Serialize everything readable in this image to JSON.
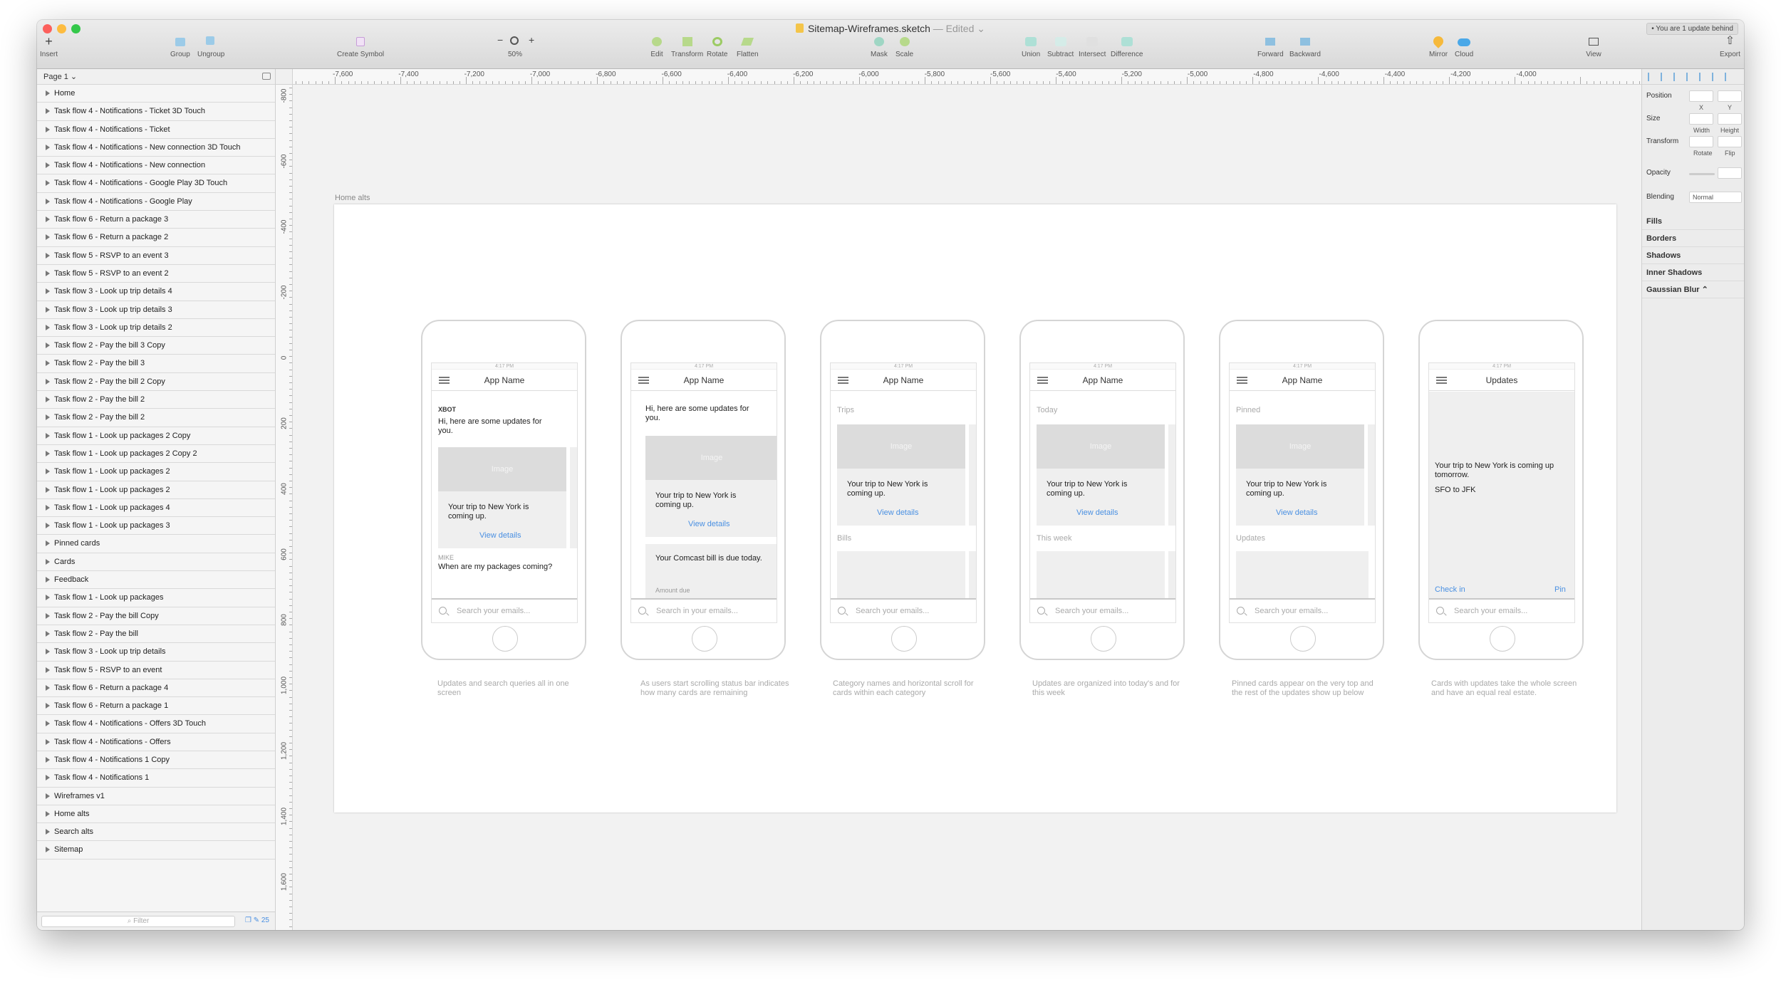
{
  "window": {
    "title": "Sitemap-Wireframes.sketch",
    "edited": " — Edited ⌄",
    "update_badge": "• You are 1 update behind"
  },
  "toolbar": {
    "insert": "Insert",
    "group": "Group",
    "ungroup": "Ungroup",
    "create_symbol": "Create Symbol",
    "zoom": "50%",
    "zoom_minus": "−",
    "zoom_plus": "+",
    "edit": "Edit",
    "transform": "Transform",
    "rotate": "Rotate",
    "flatten": "Flatten",
    "mask": "Mask",
    "scale": "Scale",
    "union": "Union",
    "subtract": "Subtract",
    "intersect": "Intersect",
    "difference": "Difference",
    "forward": "Forward",
    "backward": "Backward",
    "mirror": "Mirror",
    "cloud": "Cloud",
    "view": "View",
    "export": "Export"
  },
  "layers": {
    "page": "Page 1 ⌄",
    "items": [
      "Home",
      "Task flow 4 - Notifications - Ticket 3D Touch",
      "Task flow 4 - Notifications - Ticket",
      "Task flow 4 - Notifications - New connection 3D Touch",
      "Task flow 4 - Notifications - New connection",
      "Task flow 4 - Notifications - Google Play 3D Touch",
      "Task flow 4 - Notifications - Google Play",
      "Task flow 6 - Return a package 3",
      "Task flow 6 - Return a package 2",
      "Task flow 5 - RSVP to an event 3",
      "Task flow 5 - RSVP to an event 2",
      "Task flow 3 - Look up trip details 4",
      "Task flow 3 - Look up trip details 3",
      "Task flow 3 - Look up trip details 2",
      "Task flow 2 - Pay the bill 3 Copy",
      "Task flow 2 - Pay the bill 3",
      "Task flow 2 - Pay the bill 2 Copy",
      "Task flow 2 - Pay the bill 2",
      "Task flow 2 - Pay the bill 2",
      "Task flow 1 - Look up packages 2 Copy",
      "Task flow 1 - Look up packages 2 Copy 2",
      "Task flow 1 - Look up packages 2",
      "Task flow 1 - Look up packages 2",
      "Task flow 1 - Look up packages 4",
      "Task flow 1 - Look up packages 3",
      "Pinned cards",
      "Cards",
      "Feedback",
      "Task flow 1 - Look up packages",
      "Task flow 2 - Pay the bill Copy",
      "Task flow 2 - Pay the bill",
      "Task flow 3 - Look up trip details",
      "Task flow 5 - RSVP to an event",
      "Task flow 6 - Return a package 4",
      "Task flow 6 - Return a package 1",
      "Task flow 4 - Notifications - Offers 3D Touch",
      "Task flow 4 - Notifications - Offers",
      "Task flow 4 - Notifications 1 Copy",
      "Task flow 4 - Notifications 1",
      "Wireframes v1",
      "Home alts",
      "Search alts",
      "Sitemap"
    ],
    "filter_placeholder": "Filter",
    "count": "25"
  },
  "rulers": {
    "h": [
      "-7,600",
      "-7,400",
      "-7,200",
      "-7,000",
      "-6,800",
      "-6,600",
      "-6,400",
      "-6,200",
      "-6,000",
      "-5,800",
      "-5,600",
      "-5,400",
      "-5,200",
      "-5,000",
      "-4,800",
      "-4,600",
      "-4,400",
      "-4,200",
      "-4,000"
    ],
    "v": [
      "-800",
      "-600",
      "-400",
      "-200",
      "0",
      "200",
      "400",
      "600",
      "800",
      "1,000",
      "1,200",
      "1,400",
      "1,600"
    ]
  },
  "artboard": {
    "name": "Home alts"
  },
  "phones": {
    "time": "4:17 PM",
    "app_name": "App Name",
    "search": "Search your emails...",
    "p1": {
      "sender": "XBOT",
      "greeting": "Hi, here are some updates for you.",
      "image": "Image",
      "card": "Your trip to New York is coming up.",
      "link": "View details",
      "sender2": "MIKE",
      "question": "When are my packages coming?"
    },
    "p2": {
      "greeting": "Hi, here are some updates for you.",
      "image": "Image",
      "card": "Your trip to New York is coming up.",
      "link": "View details",
      "bill": "Your Comcast bill is due today.",
      "amount": "Amount due",
      "search": "Search in your emails..."
    },
    "p3": {
      "sec1": "Trips",
      "sec2": "Bills",
      "image": "Image",
      "card": "Your trip to New York is coming up.",
      "link": "View details"
    },
    "p4": {
      "sec1": "Today",
      "sec2": "This week",
      "image": "Image",
      "card": "Your trip to New York is coming up.",
      "link": "View details"
    },
    "p5": {
      "sec1": "Pinned",
      "sec2": "Updates",
      "image": "Image",
      "card": "Your trip to New York is coming up.",
      "link": "View details"
    },
    "p6": {
      "title": "Updates",
      "text": "Your trip to New York is coming up tomorrow.",
      "route": "SFO to JFK",
      "checkin": "Check in",
      "pin": "Pin"
    }
  },
  "captions": [
    "Updates and search queries all in one screen",
    "As users start scrolling status bar indicates how many cards are remaining",
    "Category names and horizontal scroll for cards within each category",
    "Updates are organized into today's and for this week",
    "Pinned cards appear on the very top and the rest of the updates show up below",
    "Cards with updates take the whole screen and have an equal real estate."
  ],
  "inspector": {
    "position": "Position",
    "x": "X",
    "y": "Y",
    "size": "Size",
    "width": "Width",
    "height": "Height",
    "transform": "Transform",
    "rotate": "Rotate",
    "flip": "Flip",
    "opacity": "Opacity",
    "blending": "Blending",
    "blending_value": "Normal",
    "fills": "Fills",
    "borders": "Borders",
    "shadows": "Shadows",
    "inner_shadows": "Inner Shadows",
    "gaussian_blur": "Gaussian Blur ⌃"
  },
  "colors": {
    "accent": "#4a90e2",
    "close": "#fc605c",
    "minimize": "#fdbc40",
    "zoom": "#34c84a"
  }
}
